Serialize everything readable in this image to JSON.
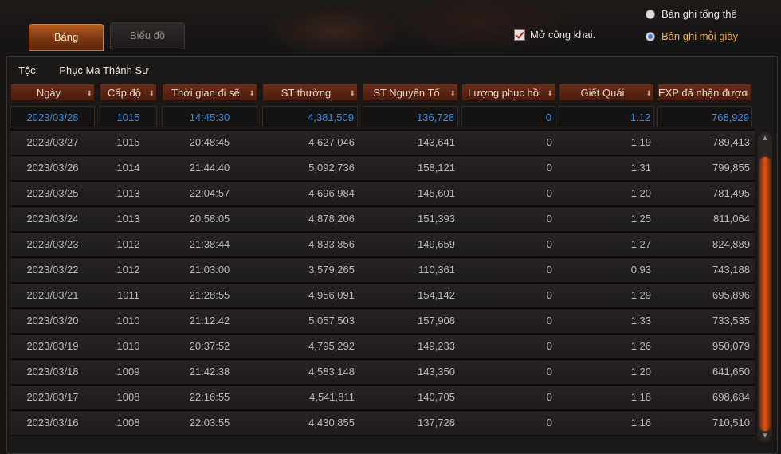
{
  "tabs": {
    "table_label": "Bảng",
    "chart_label": "Biểu đồ"
  },
  "public_toggle": {
    "label": "Mở công khai.",
    "checked": true
  },
  "record_mode": {
    "overall_label": "Bản ghi tổng thể",
    "per_second_label": "Bản ghi mỗi giây",
    "selected": "per_second"
  },
  "race": {
    "label": "Tộc:",
    "value": "Phục Ma Thánh Sư"
  },
  "columns": [
    "Ngày",
    "Cấp độ",
    "Thời gian đi sẽ",
    "ST thường",
    "ST Nguyên Tố",
    "Lượng phục hồi",
    "Giết Quái",
    "EXP đã nhận được"
  ],
  "rows": [
    [
      "2023/03/28",
      "1015",
      "14:45:30",
      "4,381,509",
      "136,728",
      "0",
      "1.12",
      "768,929"
    ],
    [
      "2023/03/27",
      "1015",
      "20:48:45",
      "4,627,046",
      "143,641",
      "0",
      "1.19",
      "789,413"
    ],
    [
      "2023/03/26",
      "1014",
      "21:44:40",
      "5,092,736",
      "158,121",
      "0",
      "1.31",
      "799,855"
    ],
    [
      "2023/03/25",
      "1013",
      "22:04:57",
      "4,696,984",
      "145,601",
      "0",
      "1.20",
      "781,495"
    ],
    [
      "2023/03/24",
      "1013",
      "20:58:05",
      "4,878,206",
      "151,393",
      "0",
      "1.25",
      "811,064"
    ],
    [
      "2023/03/23",
      "1012",
      "21:38:44",
      "4,833,856",
      "149,659",
      "0",
      "1.27",
      "824,889"
    ],
    [
      "2023/03/22",
      "1012",
      "21:03:00",
      "3,579,265",
      "110,361",
      "0",
      "0.93",
      "743,188"
    ],
    [
      "2023/03/21",
      "1011",
      "21:28:55",
      "4,956,091",
      "154,142",
      "0",
      "1.29",
      "695,896"
    ],
    [
      "2023/03/20",
      "1010",
      "21:12:42",
      "5,057,503",
      "157,908",
      "0",
      "1.33",
      "733,535"
    ],
    [
      "2023/03/19",
      "1010",
      "20:37:52",
      "4,795,292",
      "149,233",
      "0",
      "1.26",
      "950,079"
    ],
    [
      "2023/03/18",
      "1009",
      "21:42:38",
      "4,583,148",
      "143,350",
      "0",
      "1.20",
      "641,650"
    ],
    [
      "2023/03/17",
      "1008",
      "22:16:55",
      "4,541,811",
      "140,705",
      "0",
      "1.18",
      "698,684"
    ],
    [
      "2023/03/16",
      "1008",
      "22:03:55",
      "4,430,855",
      "137,728",
      "0",
      "1.16",
      "710,510"
    ]
  ],
  "colors": {
    "accent": "#e05714",
    "highlight_text": "#2f8fe8",
    "selected_radio_text": "#f0b21a"
  }
}
